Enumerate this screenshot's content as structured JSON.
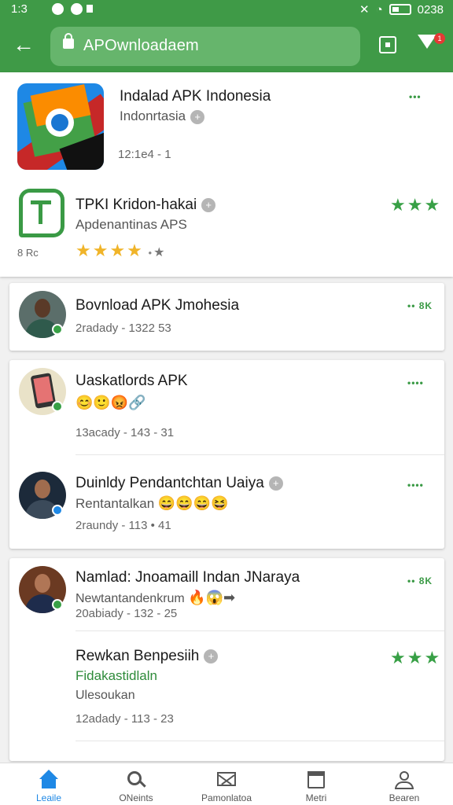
{
  "status": {
    "time": "1:3",
    "right": "0238"
  },
  "url": "APOwnloadaem",
  "top_apps": [
    {
      "title": "Indalad APK Indonesia",
      "sub": "Indonrtasia",
      "meta": "12:1e4 - 1"
    },
    {
      "title": "TPKI Kridon-hakai",
      "sub": "Apdenantinas APS",
      "small": "8 Rc",
      "stars": "★★★"
    }
  ],
  "posts": [
    {
      "title": "Bovnload APK Jmohesia",
      "meta": "2radady - 1322 53",
      "more": "•• 8K"
    },
    {
      "title": "Uaskatlords APK",
      "emoji": "😊🙂😡🔗",
      "meta": "13acady - 143 - 31",
      "more": "••••"
    },
    {
      "title": "Duinldy Pendantchtan Uaiya",
      "sub": "Rentantalkan",
      "emoji": "😄😄😄😆",
      "meta": "2raundy - 113 • 41",
      "more": "••••"
    },
    {
      "title": "Namlad: Jnoamaill Indan JNaraya",
      "sub": "Newtantandenkrum",
      "emoji": "🔥😱➡",
      "meta": "20abiady - 132 - 25",
      "more": "•• 8K"
    },
    {
      "title": "Rewkan Benpesiih",
      "sub": "Fidakastidlaln",
      "sub2": "Ulesoukan",
      "meta": "12adady - 113 - 23",
      "stars": "★★★"
    }
  ],
  "nav": [
    {
      "label": "Leaile"
    },
    {
      "label": "ONeints"
    },
    {
      "label": "Pamonlatoa"
    },
    {
      "label": "Metri"
    },
    {
      "label": "Bearen"
    }
  ],
  "colors": {
    "primary": "#3f9a47",
    "accent": "#38a046"
  }
}
